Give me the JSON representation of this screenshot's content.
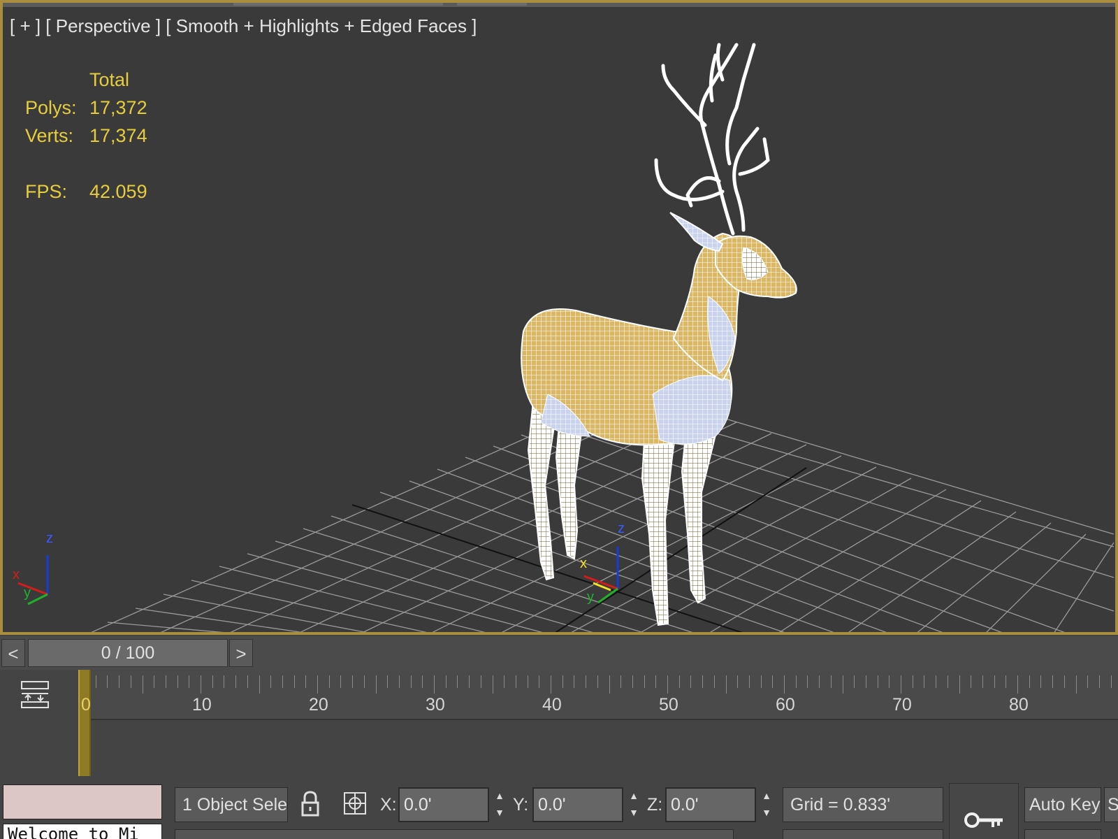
{
  "viewport": {
    "label": "[ + ] [ Perspective ] [ Smooth + Highlights + Edged Faces ]",
    "stats": {
      "header": "Total",
      "rows": [
        {
          "key": "Polys:",
          "value": "17,372"
        },
        {
          "key": "Verts:",
          "value": "17,374"
        },
        {
          "key": "FPS:",
          "value": "42.059"
        }
      ]
    },
    "axis_tripod": {
      "x": "x",
      "y": "y",
      "z": "z"
    },
    "gizmo": {
      "x": "x",
      "y": "y",
      "z": "z"
    },
    "colors": {
      "border": "#a98e3f",
      "stats": "#e7cd3c",
      "background": "#3a3a3a"
    }
  },
  "frame_bar": {
    "prev_label": "<",
    "next_label": ">",
    "slider_value": "0 / 100"
  },
  "trackbar": {
    "current_frame": "0",
    "tick_labels": [
      "10",
      "20",
      "30",
      "40",
      "50",
      "60",
      "70",
      "80"
    ]
  },
  "statusbar": {
    "listener_text": "Welcome to Mi",
    "selection": "1 Object Sele",
    "x_label": "X:",
    "x_value": "0.0'",
    "y_label": "Y:",
    "y_value": "0.0'",
    "z_label": "Z:",
    "z_value": "0.0'",
    "grid": "Grid = 0.833'",
    "auto_key": "Auto Key",
    "set_key_partial": "S"
  }
}
